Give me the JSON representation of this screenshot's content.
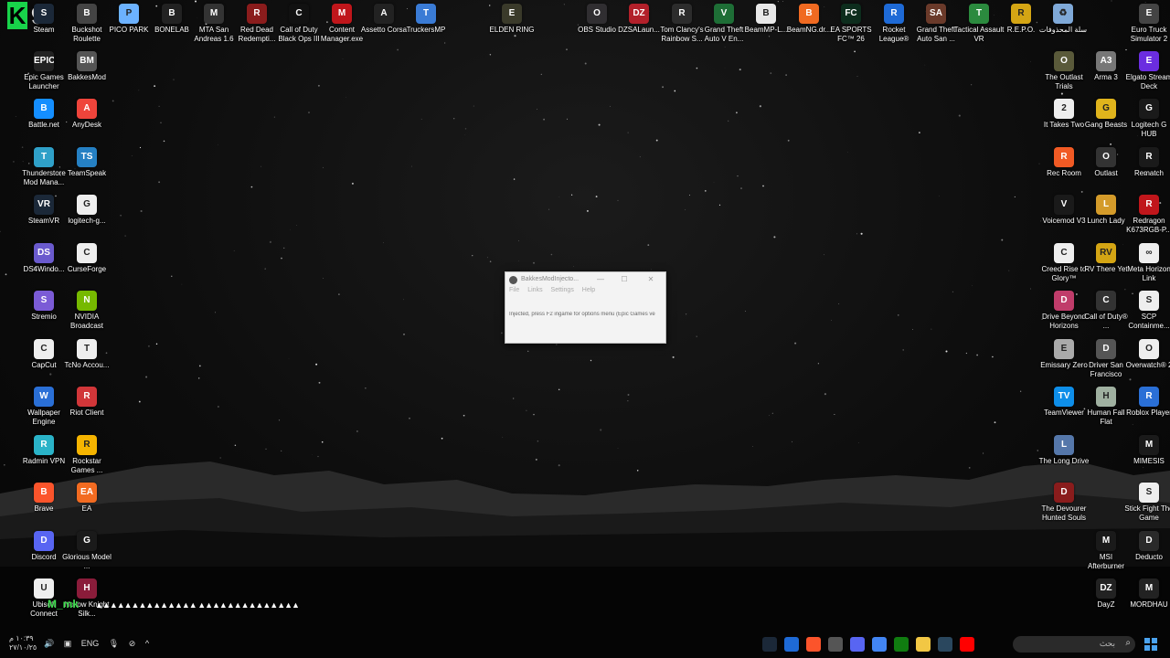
{
  "desktop_icons": [
    {
      "label": "Steam",
      "color": "#1b2838",
      "glyph": "S"
    },
    {
      "label": "Buckshot Roulette",
      "color": "#444",
      "glyph": "B"
    },
    {
      "label": "PICO PARK",
      "color": "#6cb2ff",
      "glyph": "P"
    },
    {
      "label": "BONELAB",
      "color": "#222",
      "glyph": "B"
    },
    {
      "label": "MTA San Andreas 1.6",
      "color": "#333",
      "glyph": "M"
    },
    {
      "label": "Red Dead Redempti...",
      "color": "#8a1c1c",
      "glyph": "R"
    },
    {
      "label": "Call of Duty Black Ops III",
      "color": "#111",
      "glyph": "C"
    },
    {
      "label": "Content Manager.exe",
      "color": "#c0161b",
      "glyph": "M"
    },
    {
      "label": "Assetto Corsa",
      "color": "#222",
      "glyph": "A"
    },
    {
      "label": "TruckersMP",
      "color": "#3a7bd5",
      "glyph": "T"
    },
    {
      "label": "ELDEN RING",
      "color": "#3a3a2a",
      "glyph": "E"
    },
    {
      "label": "OBS Studio",
      "color": "#302e31",
      "glyph": "O"
    },
    {
      "label": "DZSALaun...",
      "color": "#b2202a",
      "glyph": "DZ"
    },
    {
      "label": "Tom Clancy's Rainbow S...",
      "color": "#2c2c2c",
      "glyph": "R"
    },
    {
      "label": "Grand Theft Auto V En...",
      "color": "#1e6e36",
      "glyph": "V"
    },
    {
      "label": "BeamMP-L...",
      "color": "#e8e8e8",
      "glyph": "B"
    },
    {
      "label": "BeamNG.dr...",
      "color": "#f06a21",
      "glyph": "B"
    },
    {
      "label": "EA SPORTS FC™ 26",
      "color": "#0d2d1d",
      "glyph": "FC"
    },
    {
      "label": "Rocket League®",
      "color": "#1e6ad6",
      "glyph": "R"
    },
    {
      "label": "Grand Theft Auto San ...",
      "color": "#6a3a2a",
      "glyph": "SA"
    },
    {
      "label": "Tactical Assault VR",
      "color": "#2b8a3e",
      "glyph": "T"
    },
    {
      "label": "R.E.P.O.",
      "color": "#d4a514",
      "glyph": "R"
    },
    {
      "label": "سلة المحذوفات",
      "color": "#7fa9d8",
      "glyph": "♻"
    },
    {
      "label": "Euro Truck Simulator 2",
      "color": "#444",
      "glyph": "E"
    },
    {
      "label": "Epic Games Launcher",
      "color": "#222",
      "glyph": "EPIC"
    },
    {
      "label": "BakkesMod",
      "color": "#555",
      "glyph": "BM"
    },
    {
      "label": "The Outlast Trials",
      "color": "#5a5a3a",
      "glyph": "O"
    },
    {
      "label": "Arma 3",
      "color": "#777",
      "glyph": "A3"
    },
    {
      "label": "Elgato Stream Deck",
      "color": "#6b2de0",
      "glyph": "E"
    },
    {
      "label": "Battle.net",
      "color": "#148eff",
      "glyph": "B"
    },
    {
      "label": "AnyDesk",
      "color": "#ef443b",
      "glyph": "A"
    },
    {
      "label": "It Takes Two",
      "color": "#eee",
      "glyph": "2"
    },
    {
      "label": "Gang Beasts",
      "color": "#e0b41c",
      "glyph": "G"
    },
    {
      "label": "Logitech G HUB",
      "color": "#1a1a1a",
      "glyph": "G"
    },
    {
      "label": "Thunderstore Mod Mana...",
      "color": "#2fa0c8",
      "glyph": "T"
    },
    {
      "label": "TeamSpeak",
      "color": "#2580c3",
      "glyph": "TS"
    },
    {
      "label": "Rec Room",
      "color": "#f15a24",
      "glyph": "R"
    },
    {
      "label": "Outlast",
      "color": "#333",
      "glyph": "O"
    },
    {
      "label": "Rematch",
      "color": "#1a1a1a",
      "glyph": "R"
    },
    {
      "label": "SteamVR",
      "color": "#1b2838",
      "glyph": "VR"
    },
    {
      "label": "logitech-g...",
      "color": "#eee",
      "glyph": "G"
    },
    {
      "label": "Voicemod V3",
      "color": "#1a1a1a",
      "glyph": "V"
    },
    {
      "label": "Lunch Lady",
      "color": "#d49b2a",
      "glyph": "L"
    },
    {
      "label": "Redragon K673RGB-P...",
      "color": "#c0161b",
      "glyph": "R"
    },
    {
      "label": "DS4Windo...",
      "color": "#6a5acd",
      "glyph": "DS"
    },
    {
      "label": "CurseForge",
      "color": "#eee",
      "glyph": "C"
    },
    {
      "label": "Creed Rise to Glory™",
      "color": "#eee",
      "glyph": "C"
    },
    {
      "label": "RV There Yet",
      "color": "#d4a514",
      "glyph": "RV"
    },
    {
      "label": "Meta Horizon Link",
      "color": "#eee",
      "glyph": "∞"
    },
    {
      "label": "Stremio",
      "color": "#7b5bd6",
      "glyph": "S"
    },
    {
      "label": "NVIDIA Broadcast",
      "color": "#76b900",
      "glyph": "N"
    },
    {
      "label": "Drive Beyond Horizons",
      "color": "#c03c6a",
      "glyph": "D"
    },
    {
      "label": "Call of Duty® ...",
      "color": "#333",
      "glyph": "C"
    },
    {
      "label": "SCP Containme...",
      "color": "#eee",
      "glyph": "S"
    },
    {
      "label": "CapCut",
      "color": "#eee",
      "glyph": "C"
    },
    {
      "label": "TcNo Accou...",
      "color": "#eee",
      "glyph": "T"
    },
    {
      "label": "Emissary Zero",
      "color": "#aaa",
      "glyph": "E"
    },
    {
      "label": "Driver San Francisco",
      "color": "#555",
      "glyph": "D"
    },
    {
      "label": "Overwatch® 2",
      "color": "#eee",
      "glyph": "O"
    },
    {
      "label": "Wallpaper Engine",
      "color": "#2a6fd6",
      "glyph": "W"
    },
    {
      "label": "Riot Client",
      "color": "#d13639",
      "glyph": "R"
    },
    {
      "label": "TeamViewer",
      "color": "#0e8ee9",
      "glyph": "TV"
    },
    {
      "label": "Human Fall Flat",
      "color": "#9fb0a0",
      "glyph": "H"
    },
    {
      "label": "Roblox Player",
      "color": "#2a6fd6",
      "glyph": "R"
    },
    {
      "label": "Radmin VPN",
      "color": "#2ab3c8",
      "glyph": "R"
    },
    {
      "label": "Rockstar Games ...",
      "color": "#f5b400",
      "glyph": "R"
    },
    {
      "label": "The Long Drive",
      "color": "#5577aa",
      "glyph": "L"
    },
    {
      "label": "MIMESIS",
      "color": "#1a1a1a",
      "glyph": "M"
    },
    {
      "label": "Brave",
      "color": "#fb542b",
      "glyph": "B"
    },
    {
      "label": "EA",
      "color": "#f26b21",
      "glyph": "EA"
    },
    {
      "label": "The Devourer Hunted Souls",
      "color": "#8a1c1c",
      "glyph": "D"
    },
    {
      "label": "Stick Fight The Game",
      "color": "#eee",
      "glyph": "S"
    },
    {
      "label": "Discord",
      "color": "#5865f2",
      "glyph": "D"
    },
    {
      "label": "Glorious Model ...",
      "color": "#1a1a1a",
      "glyph": "G"
    },
    {
      "label": "MSI Afterburner",
      "color": "#1a1a1a",
      "glyph": "M"
    },
    {
      "label": "Deducto",
      "color": "#2a2a2a",
      "glyph": "D"
    },
    {
      "label": "Ubisoft Connect",
      "color": "#eee",
      "glyph": "U"
    },
    {
      "label": "Hollow Knight Silk...",
      "color": "#8a1c3a",
      "glyph": "H"
    },
    {
      "label": "DayZ",
      "color": "#222",
      "glyph": "DZ"
    },
    {
      "label": "MORDHAU",
      "color": "#222",
      "glyph": "M"
    }
  ],
  "overlay": {
    "k": "K",
    "nine": "9",
    "name": "M_mk",
    "tail": "▲▲▲▲▲▲▲▲▲▲▲▲▲▲ ▲▲▲▲▲▲▲▲▲▲▲▲▲▲"
  },
  "window": {
    "title": "BakkesModInjecto...",
    "minimize": "—",
    "maximize": "☐",
    "close": "✕",
    "menus": [
      "File",
      "Links",
      "Settings",
      "Help"
    ],
    "status": "Injected, press F2 ingame for options menu (Epic Games ve"
  },
  "taskbar": {
    "clock_time": "١٠:٣٩ م",
    "clock_date": "٢٧/١٠/٢٥",
    "language": "ENG",
    "search_placeholder": "بحث",
    "tray_icons": [
      "speaker-icon",
      "network-icon",
      "mic-icon",
      "notification-off-icon",
      "chevron-up-icon"
    ],
    "pinned": [
      {
        "name": "steam-pin",
        "color": "#1b2838"
      },
      {
        "name": "rocket-league-pin",
        "color": "#1e6ad6"
      },
      {
        "name": "brave-pin",
        "color": "#fb542b"
      },
      {
        "name": "bakkesmod-pin",
        "color": "#555"
      },
      {
        "name": "discord-pin",
        "color": "#5865f2"
      },
      {
        "name": "chrome-pin",
        "color": "#4285f4"
      },
      {
        "name": "xbox-pin",
        "color": "#107c10"
      },
      {
        "name": "file-explorer-pin",
        "color": "#f2c744"
      },
      {
        "name": "steam2-pin",
        "color": "#2a475e"
      },
      {
        "name": "youtube-pin",
        "color": "#ff0000"
      }
    ]
  }
}
